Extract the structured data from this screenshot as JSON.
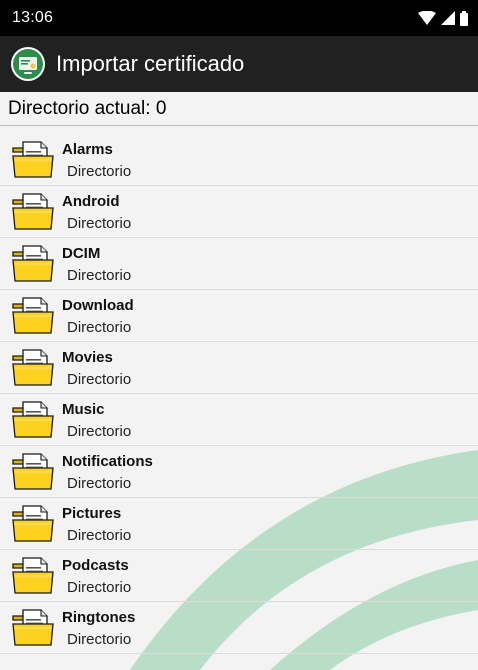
{
  "status_bar": {
    "time": "13:06",
    "icons": [
      "wifi-icon",
      "signal-icon",
      "battery-icon"
    ]
  },
  "app_bar": {
    "logo_icon": "certificate-app-logo-icon",
    "title": "Importar certificado"
  },
  "header": {
    "current_dir_label": "Directorio actual: 0"
  },
  "items": [
    {
      "name": "Alarms",
      "type": "Directorio"
    },
    {
      "name": "Android",
      "type": "Directorio"
    },
    {
      "name": "DCIM",
      "type": "Directorio"
    },
    {
      "name": "Download",
      "type": "Directorio"
    },
    {
      "name": "Movies",
      "type": "Directorio"
    },
    {
      "name": "Music",
      "type": "Directorio"
    },
    {
      "name": "Notifications",
      "type": "Directorio"
    },
    {
      "name": "Pictures",
      "type": "Directorio"
    },
    {
      "name": "Podcasts",
      "type": "Directorio"
    },
    {
      "name": "Ringtones",
      "type": "Directorio"
    }
  ],
  "colors": {
    "status_bar_bg": "#000000",
    "app_bar_bg": "#212121",
    "logo_green": "#2e8b4e",
    "folder_yellow": "#ffd21f",
    "arc_green": "#9fd1b2"
  }
}
